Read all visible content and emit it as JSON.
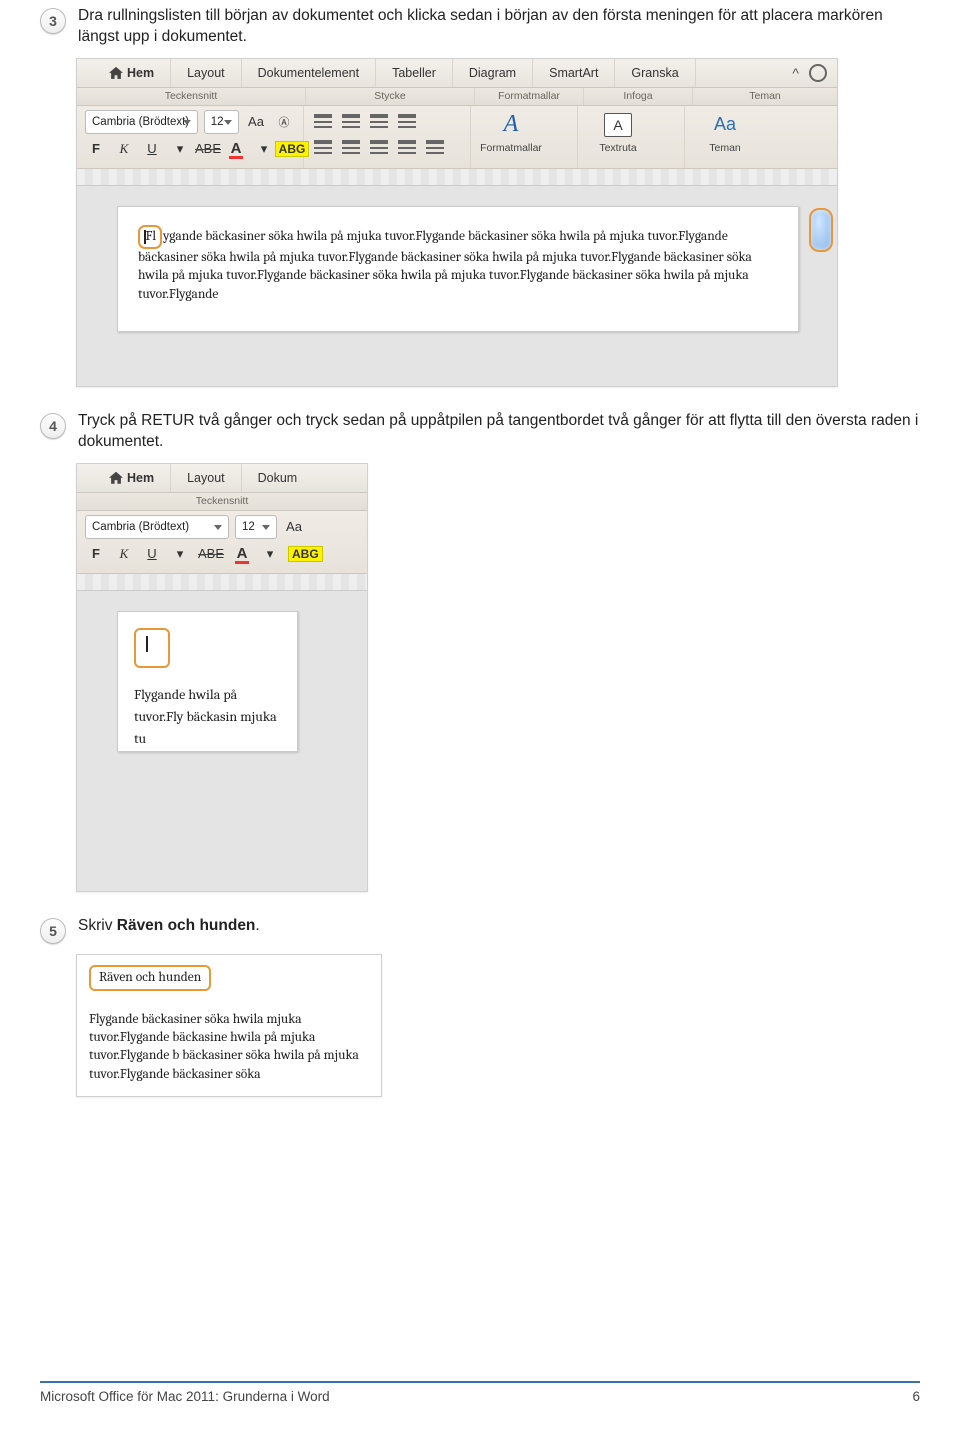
{
  "steps": {
    "s3": {
      "num": "3",
      "text_a": "Dra rullningslisten till början av dokumentet och klicka sedan i början av den första meningen för att placera markören längst upp i dokumentet."
    },
    "s4": {
      "num": "4",
      "text_a": "Tryck på RETUR två gånger och tryck sedan på uppåtpilen på tangentbordet två gånger för att flytta till den översta raden i dokumentet."
    },
    "s5": {
      "num": "5",
      "text_a": "Skriv ",
      "bold": "Räven och hunden",
      "text_b": "."
    }
  },
  "ribbon": {
    "tabs": [
      "Hem",
      "Layout",
      "Dokumentelement",
      "Tabeller",
      "Diagram",
      "SmartArt",
      "Granska"
    ],
    "caret": "^",
    "groups_full": [
      "Teckensnitt",
      "Stycke",
      "Formatmallar",
      "Infoga",
      "Teman"
    ],
    "groups_small": [
      "Teckensnitt"
    ],
    "font_name": "Cambria (Brödtext)",
    "font_size": "12",
    "Aa": "Aa",
    "F": "F",
    "K": "K",
    "U": "U",
    "ABE": "ABE",
    "A": "A",
    "ABG": "ABG",
    "big_formatmallar": "Formatmallar",
    "big_textruta": "Textruta",
    "big_teman": "Teman",
    "big_A": "A",
    "big_boxA": "A",
    "big_Aa": "Aa"
  },
  "doc": {
    "cursor_prefix": "Fl",
    "body_full": "ygande bäckasiner söka hwila på mjuka tuvor.Flygande bäckasiner söka hwila på mjuka tuvor.Flygande bäckasiner söka hwila på mjuka tuvor.Flygande bäckasiner söka hwila på mjuka tuvor.Flygande bäckasiner söka hwila på mjuka tuvor.Flygande bäckasiner söka hwila på mjuka tuvor.Flygande bäckasiner söka hwila på mjuka tuvor.Flygande",
    "body_small": "Flygande hwila på tuvor.Fly bäckasin mjuka tu",
    "title_box": "Räven och hunden",
    "body3": "Flygande bäckasiner söka hwila mjuka tuvor.Flygande bäckasine hwila på mjuka tuvor.Flygande b bäckasiner söka hwila på mjuka tuvor.Flygande bäckasiner söka"
  },
  "footer": {
    "left": "Microsoft Office för Mac 2011: Grunderna i Word",
    "right": "6"
  }
}
